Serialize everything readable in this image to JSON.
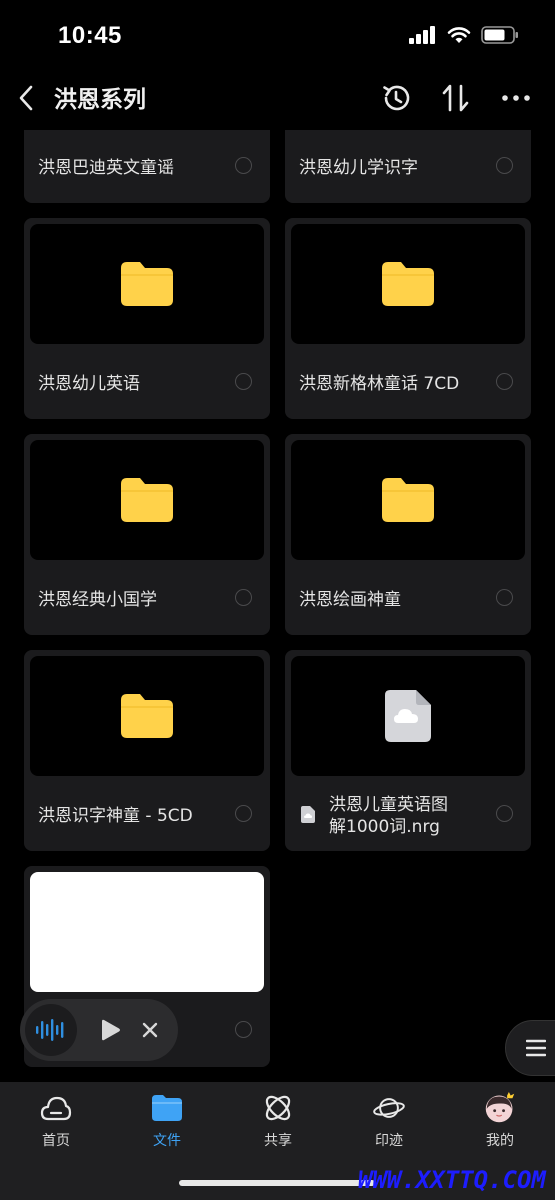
{
  "status_bar": {
    "time": "10:45"
  },
  "header": {
    "title": "洪恩系列"
  },
  "files": [
    {
      "name": "洪恩巴迪英文童谣",
      "type": "folder"
    },
    {
      "name": "洪恩幼儿学识字",
      "type": "folder"
    },
    {
      "name": "洪恩幼儿英语",
      "type": "folder"
    },
    {
      "name": "洪恩新格林童话 7CD",
      "type": "folder"
    },
    {
      "name": "洪恩经典小国学",
      "type": "folder"
    },
    {
      "name": "洪恩绘画神童",
      "type": "folder"
    },
    {
      "name": "洪恩识字神童 - 5CD",
      "type": "folder"
    },
    {
      "name": "洪恩儿童英语图解1000词.nrg",
      "line1": "洪恩儿童英语图",
      "line2": "解1000词.nrg",
      "type": "file"
    },
    {
      "name": "",
      "type": "file"
    }
  ],
  "bottom_nav": [
    {
      "label": "首页",
      "icon": "cloud-icon"
    },
    {
      "label": "文件",
      "icon": "folder-icon",
      "active": true
    },
    {
      "label": "共享",
      "icon": "atom-icon"
    },
    {
      "label": "印迹",
      "icon": "planet-icon"
    },
    {
      "label": "我的",
      "icon": "avatar-icon"
    }
  ],
  "watermark": "WWW.XXTTQ.COM",
  "colors": {
    "accent": "#3fa3f5",
    "folder": "#ffd24a",
    "card": "#1b1b1d"
  }
}
